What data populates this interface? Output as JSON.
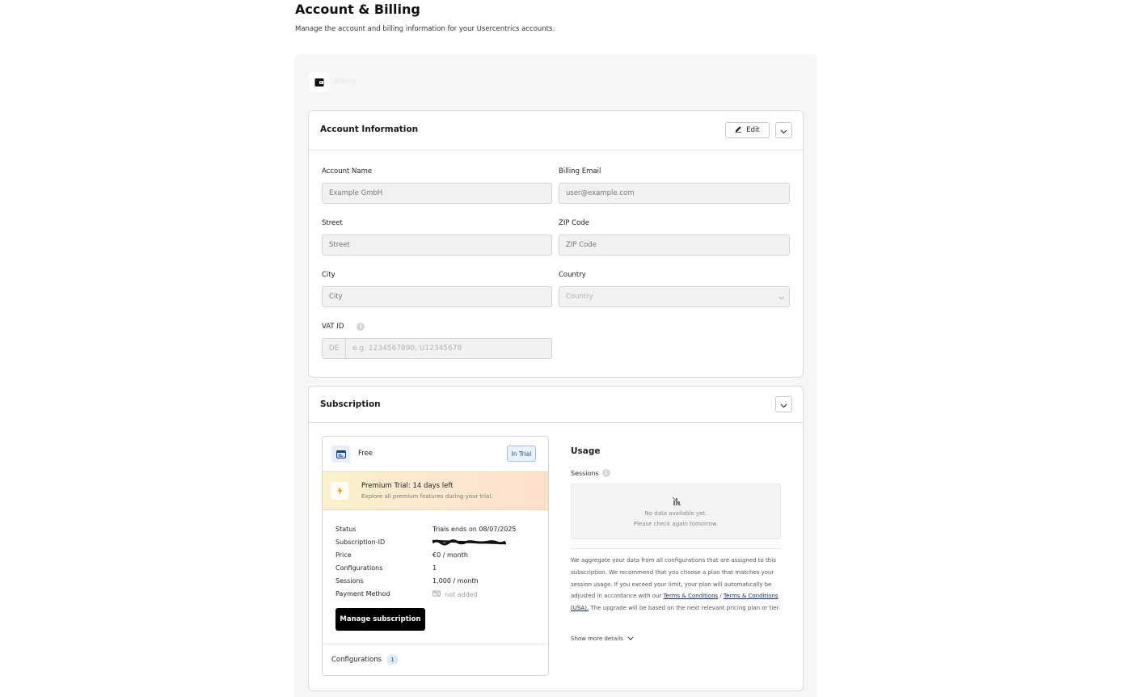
{
  "page": {
    "title": "Account & Billing",
    "subtitle": "Manage the account and billing information for your Usercentrics accounts.",
    "wallet_label": "Billing"
  },
  "account_info": {
    "title": "Account Information",
    "edit_label": "Edit",
    "fields": {
      "account_name": {
        "label": "Account Name",
        "placeholder": "Example GmbH",
        "value": ""
      },
      "billing_email": {
        "label": "Billing Email",
        "placeholder": "user@example.com",
        "value": ""
      },
      "street": {
        "label": "Street",
        "placeholder": "Street",
        "value": ""
      },
      "zip": {
        "label": "ZIP Code",
        "placeholder": "ZIP Code",
        "value": ""
      },
      "city": {
        "label": "City",
        "placeholder": "City",
        "value": ""
      },
      "country": {
        "label": "Country",
        "placeholder": "Country",
        "value": ""
      },
      "vat": {
        "label": "VAT ID",
        "prefix": "DE",
        "placeholder": "e.g. 1234567890, U12345678",
        "value": ""
      }
    }
  },
  "subscription": {
    "title": "Subscription",
    "plan": {
      "name": "Free",
      "badge": "In Trial",
      "promo_title": "Premium Trial: 14 days left",
      "promo_desc": "Explore all premium features during your trial.",
      "details": {
        "status_label": "Status",
        "status_value": "Trials ends on 08/07/2025",
        "subscription_id_label": "Subscription-ID",
        "price_label": "Price",
        "price_value": "€0 / month",
        "configurations_label": "Configurations",
        "configurations_value": "1",
        "sessions_label": "Sessions",
        "sessions_value": "1,000 / month",
        "payment_method_label": "Payment Method",
        "payment_method_value": "not added"
      },
      "manage_label": "Manage subscription",
      "footer_configurations_label": "Configurations",
      "footer_configurations_count": "1"
    },
    "usage": {
      "title": "Usage",
      "sessions_label": "Sessions",
      "empty_line1": "No data available yet.",
      "empty_line2": "Please check again tomorrow.",
      "para_part1": "We aggregate your data from all configurations that are assigned to this subscription. We recommend that you choose a plan that matches your session usage. If you exceed your limit, your plan will automatically be adjusted in accordance with our",
      "link_terms": "Terms & Conditions",
      "separator": "/",
      "link_terms_usa": "Terms & Conditions (USA).",
      "para_part2": "The upgrade will be based on the next relevant pricing plan or tier.",
      "show_more": "Show more details"
    }
  }
}
